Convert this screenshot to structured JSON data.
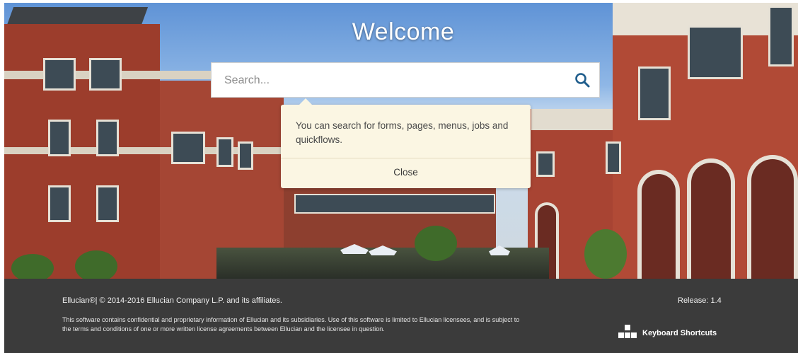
{
  "page": {
    "welcome_title": "Welcome"
  },
  "search": {
    "placeholder": "Search...",
    "icon": "search-icon"
  },
  "tooltip": {
    "message": "You can search for forms, pages, menus, jobs and quickflows.",
    "close_label": "Close"
  },
  "footer": {
    "copyright": "Ellucian®| © 2014-2016 Ellucian Company L.P. and its affiliates.",
    "legal": "This software contains confidential and proprietary information of Ellucian and its subsidiaries. Use of this software is limited to Ellucian licensees, and is subject to the terms and conditions of one or more written license agreements between Ellucian and the licensee in question.",
    "release": "Release: 1.4",
    "keyboard_shortcuts": "Keyboard Shortcuts"
  },
  "colors": {
    "footer_bg": "#3b3b3b",
    "tooltip_bg": "#fbf6e3",
    "search_icon": "#1f5d8c"
  }
}
